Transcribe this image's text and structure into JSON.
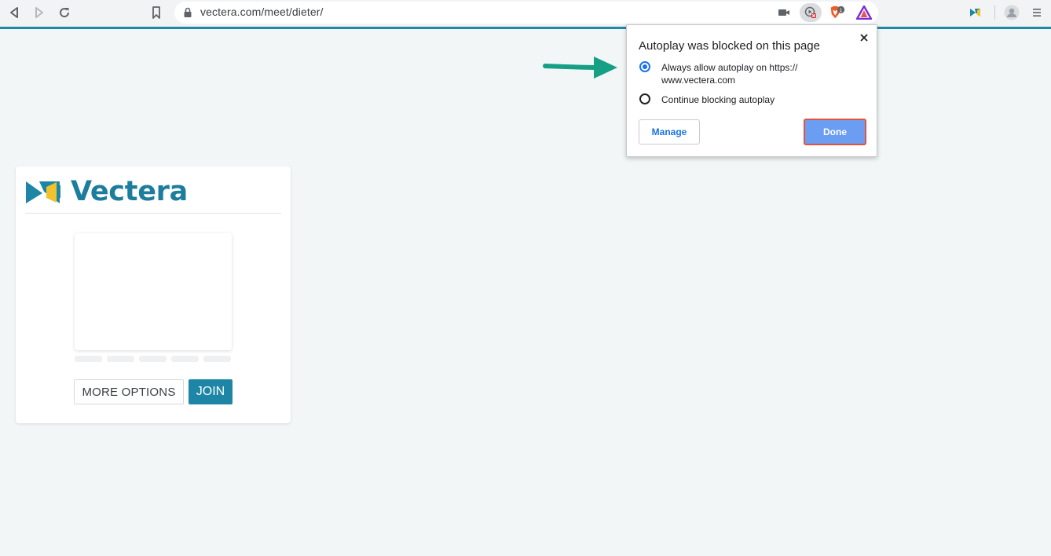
{
  "browser": {
    "url": "vectera.com/meet/dieter/",
    "extension_badge": "1",
    "icons": [
      "back-icon",
      "forward-icon",
      "reload-icon",
      "bookmark-icon",
      "lock-icon",
      "camera-icon",
      "autoplay-blocked-icon",
      "brave-shields-icon",
      "brave-rewards-icon",
      "vectera-extension-icon",
      "profile-icon",
      "menu-icon"
    ]
  },
  "popup": {
    "title": "Autoplay was blocked on this page",
    "options": [
      {
        "label_line1": "Always allow autoplay on https://",
        "label_line2": "www.vectera.com",
        "selected": true
      },
      {
        "label_line1": "Continue blocking autoplay",
        "label_line2": "",
        "selected": false
      }
    ],
    "manage_label": "Manage",
    "done_label": "Done"
  },
  "card": {
    "brand": "Vectera",
    "more_options_label": "MORE OPTIONS",
    "join_label": "JOIN"
  },
  "colors": {
    "accent": "#1d86a6",
    "brand_text": "#1d7d9c",
    "arrow": "#15a085",
    "done_bg": "#6b9ef2",
    "done_border": "#e3523b"
  }
}
